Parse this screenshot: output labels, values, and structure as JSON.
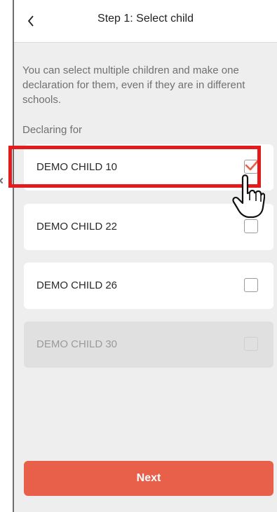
{
  "header": {
    "back_icon": "chevron-left-icon",
    "title": "Step 1: Select child"
  },
  "intro_text": "You can select multiple children and make one declaration for them, even if they are in different schools.",
  "section_label": "Declaring for",
  "children": [
    {
      "label": "DEMO CHILD 10",
      "checked": true,
      "disabled": false
    },
    {
      "label": "DEMO CHILD 22",
      "checked": false,
      "disabled": false
    },
    {
      "label": "DEMO CHILD 26",
      "checked": false,
      "disabled": false
    },
    {
      "label": "DEMO CHILD 30",
      "checked": false,
      "disabled": true
    }
  ],
  "next_label": "Next",
  "colors": {
    "accent": "#e8604a",
    "highlight": "#e31b1b",
    "check": "#e8604a",
    "background": "#eeeeee"
  },
  "overlay": {
    "pointer_icon": "hand-pointer-icon"
  }
}
